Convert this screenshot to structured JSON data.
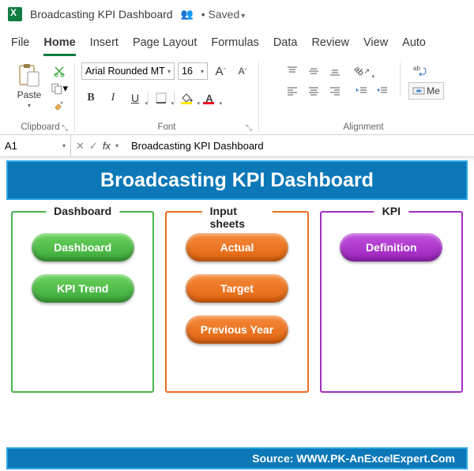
{
  "titlebar": {
    "document_name": "Broadcasting KPI Dashboard",
    "saved_status": "• Saved"
  },
  "tabs": {
    "file": "File",
    "home": "Home",
    "insert": "Insert",
    "page_layout": "Page Layout",
    "formulas": "Formulas",
    "data": "Data",
    "review": "Review",
    "view": "View",
    "auto": "Auto"
  },
  "ribbon": {
    "clipboard": {
      "paste": "Paste",
      "group_label": "Clipboard"
    },
    "font": {
      "family": "Arial Rounded MT",
      "size": "16",
      "bold": "B",
      "italic": "I",
      "underline": "U",
      "bigA": "A",
      "smallA": "A",
      "group_label": "Font"
    },
    "alignment": {
      "group_label": "Alignment",
      "merge": "Me"
    }
  },
  "formula_bar": {
    "cell_ref": "A1",
    "fx": "fx",
    "value": "Broadcasting KPI Dashboard"
  },
  "sheet": {
    "banner": "Broadcasting KPI Dashboard",
    "cards": {
      "dashboard": {
        "title": "Dashboard",
        "items": [
          "Dashboard",
          "KPI Trend"
        ]
      },
      "input": {
        "title": "Input sheets",
        "items": [
          "Actual",
          "Target",
          "Previous Year"
        ]
      },
      "kpi": {
        "title": "KPI",
        "items": [
          "Definition"
        ]
      }
    },
    "footer": "Source: WWW.PK-AnExcelExpert.Com"
  },
  "colors": {
    "excel_green": "#107c41",
    "banner_blue": "#0c78b8",
    "card_green": "#47b34b",
    "card_orange": "#e86d1f",
    "card_purple": "#a030c0"
  }
}
